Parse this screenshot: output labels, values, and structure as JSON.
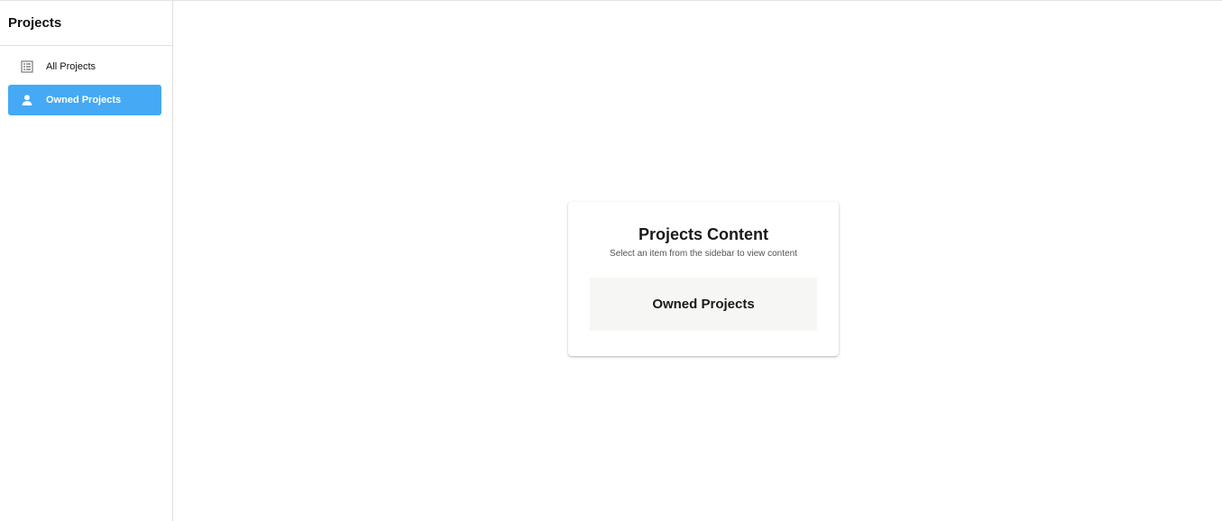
{
  "sidebar": {
    "title": "Projects",
    "items": [
      {
        "label": "All Projects",
        "icon": "list-icon",
        "active": false
      },
      {
        "label": "Owned Projects",
        "icon": "person-icon",
        "active": true
      }
    ]
  },
  "main": {
    "card": {
      "title": "Projects Content",
      "subtitle": "Select an item from the sidebar to view content",
      "selected": "Owned Projects"
    }
  },
  "colors": {
    "accent": "#45a9f5",
    "selected_box_bg": "#f6f6f4",
    "border": "#e0e0e0"
  }
}
